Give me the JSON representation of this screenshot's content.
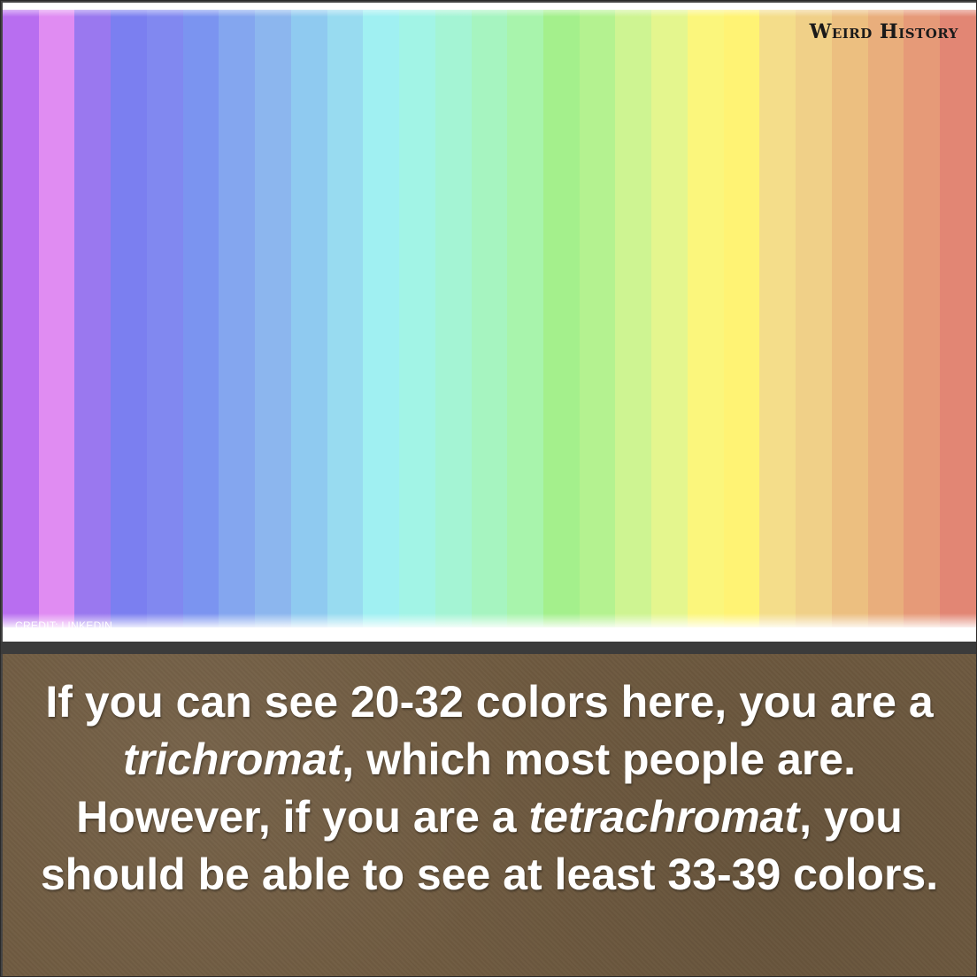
{
  "brand": {
    "name": "Weird History"
  },
  "credit": "CREDIT: LINKEDIN",
  "colors": {
    "panel_bg": "#6f5a40",
    "text": "#ffffff",
    "stripes": [
      "#b86ef0",
      "#e08cf2",
      "#9a78ef",
      "#7b7ff0",
      "#8188f0",
      "#7b94f0",
      "#84a6ef",
      "#8cb6ee",
      "#8fcaf0",
      "#98dbf0",
      "#a0f0f2",
      "#a2f4e6",
      "#a4f4d4",
      "#a6f4c0",
      "#a8f4ac",
      "#a4f08c",
      "#b4f290",
      "#cef492",
      "#e4f68e",
      "#fbf67c",
      "#fff374",
      "#f4dd8a",
      "#f0d088",
      "#ecbf80",
      "#e9ae7c",
      "#e69a78",
      "#e28674"
    ]
  },
  "message": {
    "part1": "If you can see 20-32 colors here, you are a ",
    "emph1": "trichromat",
    "part2": ", which most people are. However, if you are a ",
    "emph2": "tetrachromat",
    "part3": ", you should be able to see at least 33-39 colors."
  }
}
